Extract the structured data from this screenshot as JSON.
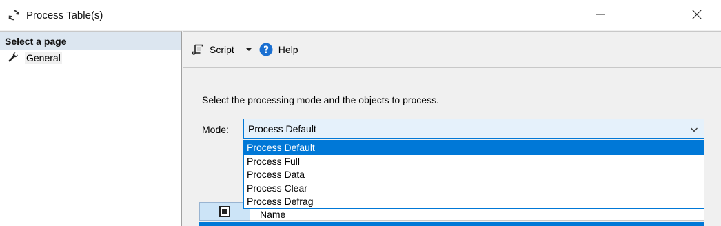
{
  "window": {
    "title": "Process Table(s)",
    "icon": "refresh-cycle-icon",
    "controls": [
      "minimize-icon",
      "maximize-icon",
      "close-icon"
    ]
  },
  "left_pane": {
    "header": "Select a page",
    "pages": [
      {
        "label": "General",
        "icon": "wrench-icon"
      }
    ]
  },
  "toolbar": {
    "script_label": "Script",
    "help_label": "Help"
  },
  "main": {
    "instruction": "Select the processing mode and the objects to process.",
    "mode_label": "Mode:",
    "mode_value": "Process Default",
    "mode_options": [
      "Process Default",
      "Process Full",
      "Process Data",
      "Process Clear",
      "Process Defrag"
    ],
    "selected_option": "Process Default",
    "table": {
      "columns": [
        "Name"
      ]
    }
  },
  "colors": {
    "accent": "#0078d7",
    "header_bg": "#dce6f0",
    "select_bg": "#e5f1fb"
  }
}
